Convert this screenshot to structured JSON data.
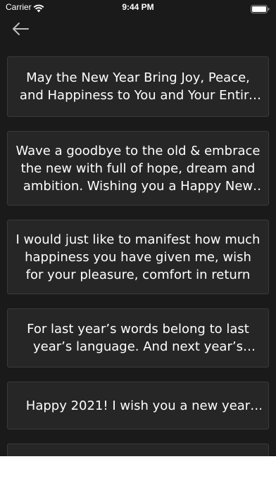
{
  "status_bar": {
    "carrier": "Carrier",
    "time": "9:44 PM"
  },
  "nav": {
    "back_icon": "arrow-left-icon"
  },
  "colors": {
    "background": "#1a1a1a",
    "card_background": "#262626",
    "card_border": "#3a3a3a",
    "text": "#ffffff"
  },
  "quotes": [
    {
      "text": "May the New Year Bring Joy, Peace, and Happiness to You and Your Entire Family"
    },
    {
      "text": "Wave a goodbye to the old & embrace the new with full of hope, dream and ambition. Wishing you a Happy New Year"
    },
    {
      "text": "I would just like to manifest how much happiness you have given me, wish for your pleasure, comfort in return"
    },
    {
      "text": "For last year’s words belong to last year’s language. And next year’s words await another voice"
    },
    {
      "text": "Happy 2021! I wish you a new year filled with happiness"
    }
  ]
}
